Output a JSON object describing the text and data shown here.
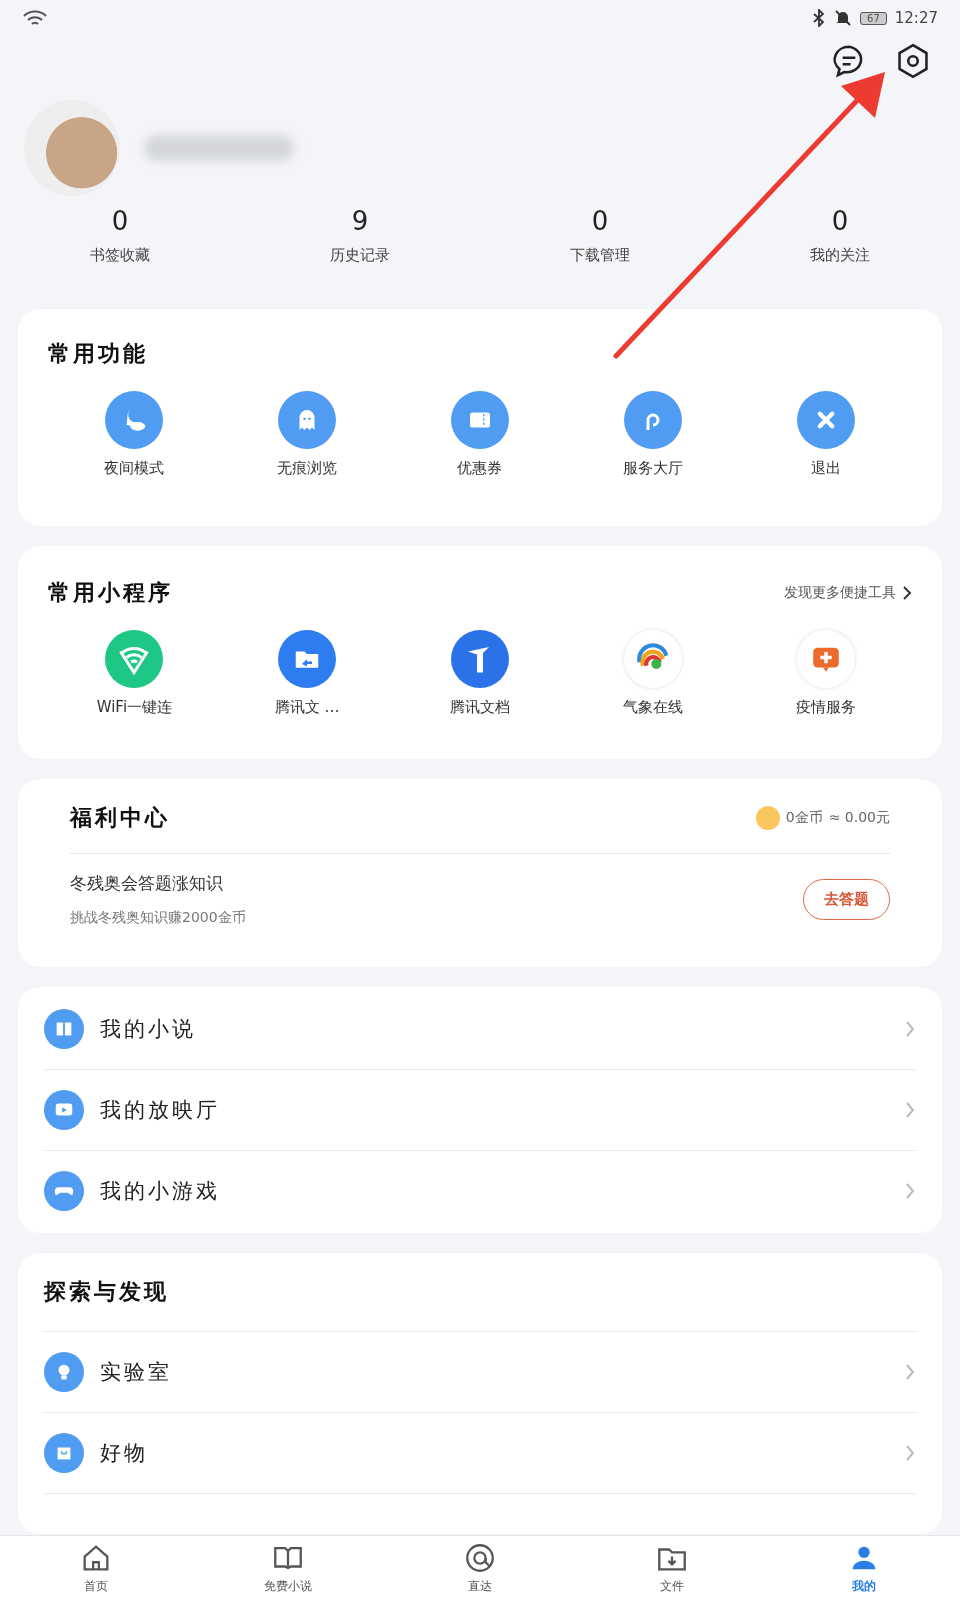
{
  "status_bar": {
    "time": "12:27",
    "battery": "67"
  },
  "stats": [
    {
      "value": "0",
      "label": "书签收藏"
    },
    {
      "value": "9",
      "label": "历史记录"
    },
    {
      "value": "0",
      "label": "下载管理"
    },
    {
      "value": "0",
      "label": "我的关注"
    }
  ],
  "common_functions": {
    "title": "常用功能",
    "items": [
      {
        "label": "夜间模式",
        "kind": "night"
      },
      {
        "label": "无痕浏览",
        "kind": "ghost"
      },
      {
        "label": "优惠券",
        "kind": "coupon"
      },
      {
        "label": "服务大厅",
        "kind": "link"
      },
      {
        "label": "退出",
        "kind": "exit"
      }
    ]
  },
  "mini_programs": {
    "title": "常用小程序",
    "more": "发现更多便捷工具",
    "items": [
      {
        "label": "WiFi一键连",
        "kind": "wifi"
      },
      {
        "label": "腾讯文 …",
        "kind": "folder"
      },
      {
        "label": "腾讯文档",
        "kind": "docs"
      },
      {
        "label": "气象在线",
        "kind": "weather"
      },
      {
        "label": "疫情服务",
        "kind": "health"
      }
    ]
  },
  "welfare": {
    "title": "福利中心",
    "coins": "0金币",
    "approx": "≈ 0.00元",
    "task_title": "冬残奥会答题涨知识",
    "task_desc": "挑战冬残奥知识赚2000金币",
    "button": "去答题"
  },
  "my_list": [
    {
      "label": "我的小说",
      "kind": "book"
    },
    {
      "label": "我的放映厅",
      "kind": "play"
    },
    {
      "label": "我的小游戏",
      "kind": "game"
    }
  ],
  "explore": {
    "title": "探索与发现",
    "items": [
      {
        "label": "实验室",
        "kind": "bulb"
      },
      {
        "label": "好物",
        "kind": "bag"
      }
    ]
  },
  "tab_bar": [
    {
      "label": "首页",
      "kind": "home",
      "selected": false
    },
    {
      "label": "免费小说",
      "kind": "book",
      "selected": false
    },
    {
      "label": "直达",
      "kind": "at",
      "selected": false
    },
    {
      "label": "文件",
      "kind": "file",
      "selected": false
    },
    {
      "label": "我的",
      "kind": "me",
      "selected": true
    }
  ]
}
